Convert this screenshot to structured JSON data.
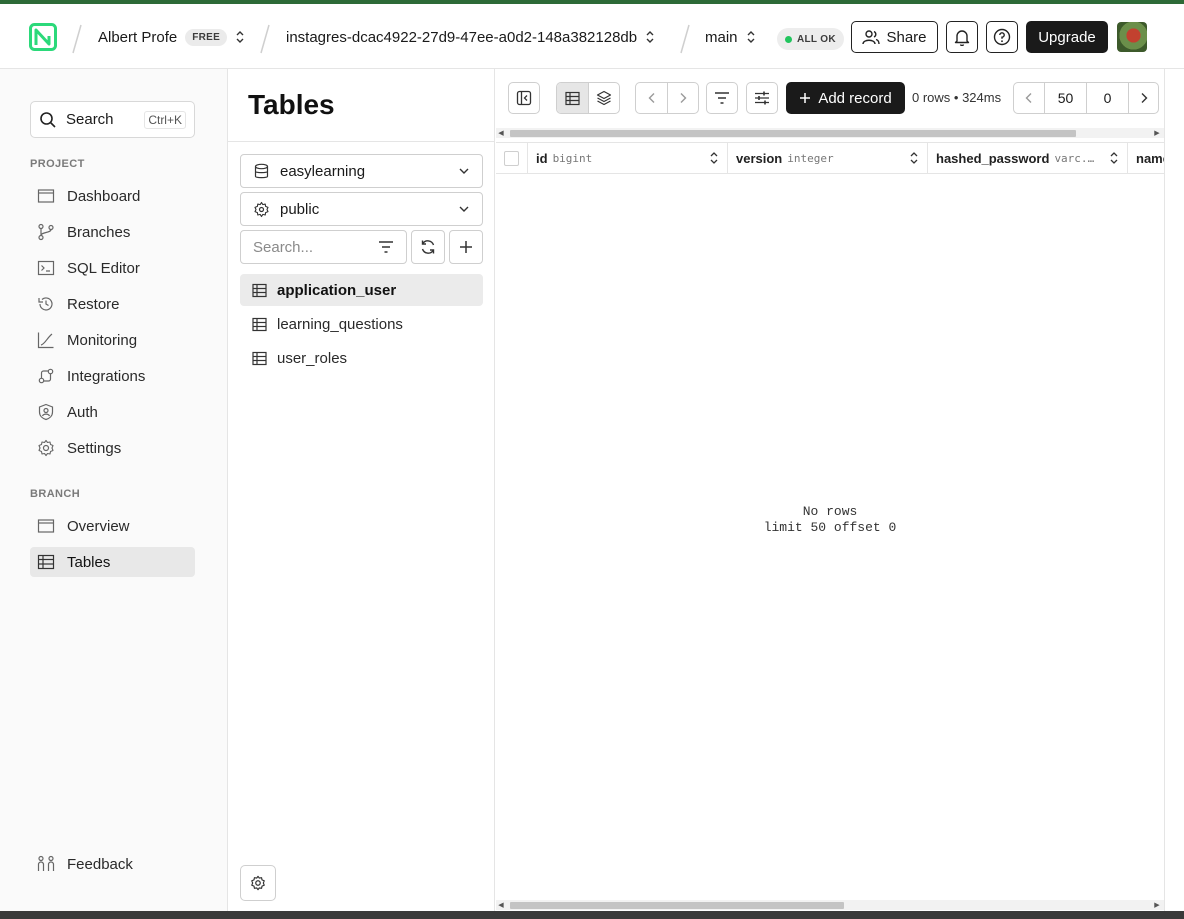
{
  "header": {
    "org_name": "Albert Profe",
    "plan_badge": "FREE",
    "project_name": "instagres-dcac4922-27d9-47ee-a0d2-148a382128db",
    "branch_name": "main",
    "status_text": "ALL OK",
    "share_label": "Share",
    "upgrade_label": "Upgrade"
  },
  "sidebar": {
    "search_label": "Search",
    "search_shortcut": "Ctrl+K",
    "project_section": "PROJECT",
    "project_items": [
      {
        "label": "Dashboard",
        "icon": "dashboard-icon"
      },
      {
        "label": "Branches",
        "icon": "branches-icon"
      },
      {
        "label": "SQL Editor",
        "icon": "sql-editor-icon"
      },
      {
        "label": "Restore",
        "icon": "restore-icon"
      },
      {
        "label": "Monitoring",
        "icon": "monitoring-icon"
      },
      {
        "label": "Integrations",
        "icon": "integrations-icon"
      },
      {
        "label": "Auth",
        "icon": "auth-icon"
      },
      {
        "label": "Settings",
        "icon": "settings-icon"
      }
    ],
    "branch_section": "BRANCH",
    "branch_items": [
      {
        "label": "Overview",
        "icon": "overview-icon"
      },
      {
        "label": "Tables",
        "icon": "tables-icon",
        "active": true
      }
    ],
    "feedback_label": "Feedback"
  },
  "tables_panel": {
    "title": "Tables",
    "database": "easylearning",
    "schema": "public",
    "search_placeholder": "Search...",
    "tables": [
      {
        "name": "application_user",
        "active": true
      },
      {
        "name": "learning_questions"
      },
      {
        "name": "user_roles"
      }
    ]
  },
  "main": {
    "add_record_label": "Add record",
    "rows_info": "0 rows • 324ms",
    "page_limit": "50",
    "page_offset": "0",
    "columns": [
      {
        "name": "id",
        "type": "bigint"
      },
      {
        "name": "version",
        "type": "integer"
      },
      {
        "name": "hashed_password",
        "type": "varc..."
      },
      {
        "name": "name",
        "type": ""
      }
    ],
    "empty_line1": "No rows",
    "empty_line2": "limit 50 offset 0"
  },
  "colors": {
    "accent_green": "#2d6a37",
    "status_green": "#22c55e",
    "dark_button": "#1a1a1a"
  }
}
